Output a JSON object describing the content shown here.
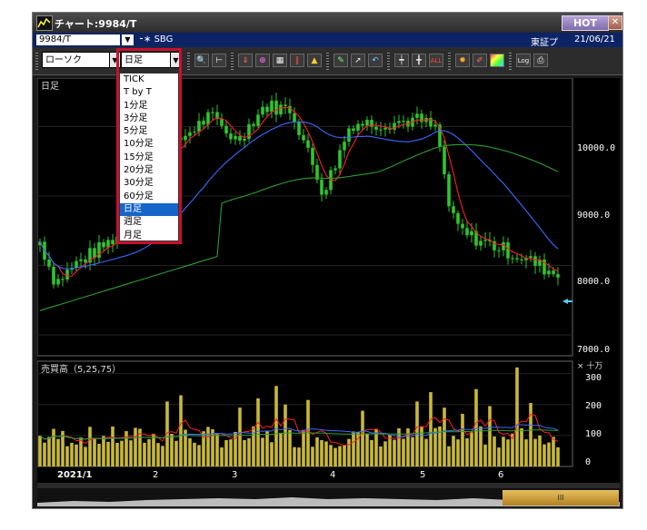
{
  "window": {
    "title": "チャート:9984/T",
    "hot_label": "HOT",
    "close_label": "✕"
  },
  "symbol_bar": {
    "code": "9984/T",
    "name": "SBG",
    "exchange": "東証プ",
    "date": "21/06/21"
  },
  "toolbar": {
    "chart_type": "ローソク",
    "period": "日足",
    "icons": [
      "zoom-icon",
      "ruler-icon",
      "download-icon",
      "search-icon",
      "table-icon",
      "vertical-lines-icon",
      "alert-icon",
      "pencil-icon",
      "cursor-icon",
      "undo-icon",
      "candle-icon",
      "candle-compare-icon",
      "all-icon",
      "gear-icon",
      "brush-icon",
      "color-icon",
      "log-icon",
      "print-icon"
    ],
    "all_label": "ALL",
    "log_label": "Log"
  },
  "period_options": [
    "TICK",
    "T by T",
    "1分足",
    "3分足",
    "5分足",
    "10分足",
    "15分足",
    "20分足",
    "30分足",
    "60分足",
    "日足",
    "週足",
    "月足"
  ],
  "selected_period": "日足",
  "price_panel": {
    "label": "日足",
    "y_ticks": [
      "10000.0",
      "9000.0",
      "8000.0",
      "7000.0"
    ],
    "ylim": [
      6700,
      10700
    ]
  },
  "volume_panel": {
    "label": "売買高（5,25,75）",
    "unit": "× 十万",
    "y_ticks": [
      "300",
      "200",
      "100",
      "0"
    ],
    "ylim": [
      0,
      340
    ]
  },
  "x_axis": {
    "labels": [
      "2021/1",
      "2",
      "3",
      "4",
      "5",
      "6"
    ]
  },
  "scrollbar": {
    "thumb_label": "III"
  },
  "colors": {
    "up": "#2ec52e",
    "down": "#2ec52e",
    "ma5": "#ff2020",
    "ma25": "#3a6cff",
    "ma75": "#2e9e2e",
    "volume": "#c8b838",
    "accent": "#c8102e",
    "selection": "#1665c9"
  },
  "chart_data": {
    "type": "line",
    "x": [
      "2021/1",
      "2",
      "3",
      "4",
      "5",
      "6"
    ],
    "series": [],
    "ylim": [
      6700,
      10700
    ]
  }
}
